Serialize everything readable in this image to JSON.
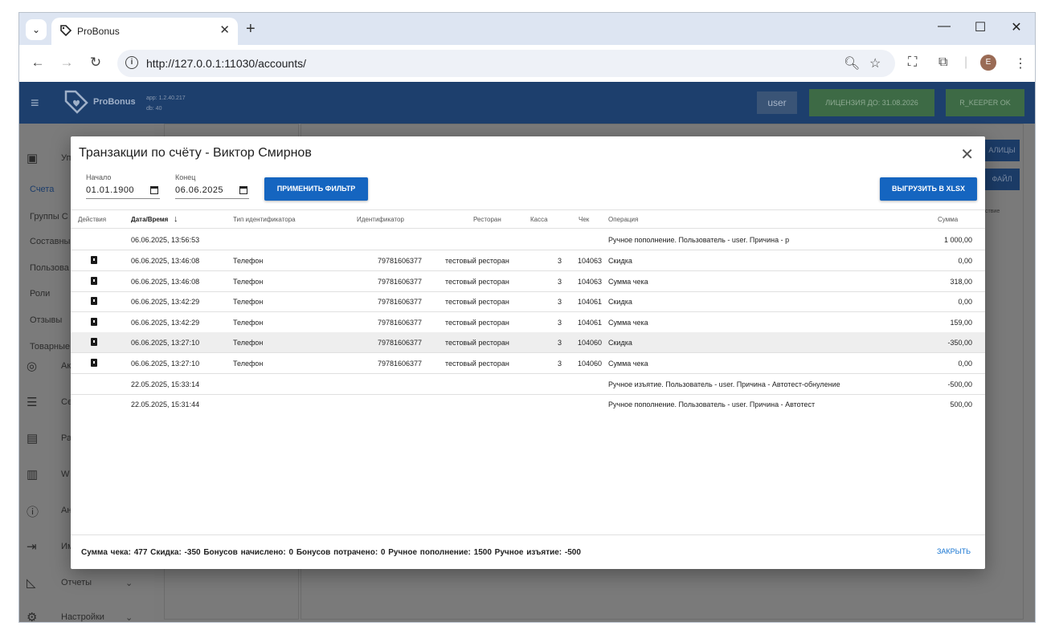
{
  "browser": {
    "tab_title": "ProBonus",
    "tab_close": "✕",
    "new_tab": "+",
    "url": "http://127.0.0.1:11030/accounts/",
    "profile_initial": "E",
    "window_controls": {
      "minimize": "—",
      "maximize": "☐",
      "close": "✕"
    }
  },
  "app": {
    "logo_text": "ProBonus",
    "version_app": "app: 1.2.40.217",
    "version_db": "db: 40",
    "user_label": "user",
    "license_label": "ЛИЦЕНЗИЯ ДО: 31.08.2026",
    "keeper_label": "R_KEEPER OK"
  },
  "sidebar": {
    "items": [
      {
        "label": "Уп"
      },
      {
        "label": "Счета"
      },
      {
        "label": "Группы С"
      },
      {
        "label": "Составны"
      },
      {
        "label": "Пользова"
      },
      {
        "label": "Роли"
      },
      {
        "label": "Отзывы"
      },
      {
        "label": "Товарные"
      }
    ],
    "icon_items": [
      {
        "icon": "eye-icon",
        "label": "Ак"
      },
      {
        "icon": "list-icon",
        "label": "Се"
      },
      {
        "icon": "card-icon",
        "label": "Ра"
      },
      {
        "icon": "wallet-icon",
        "label": "W"
      },
      {
        "icon": "alert-icon",
        "label": "Ан"
      },
      {
        "icon": "import-icon",
        "label": "Им"
      },
      {
        "icon": "chart-icon",
        "label": "Отчеты"
      },
      {
        "icon": "gear-icon",
        "label": "Настройки"
      }
    ]
  },
  "background": {
    "btn_tables": "АЛИЦЫ",
    "btn_file": "ФАЙЛ",
    "col_partial": "ствие"
  },
  "modal": {
    "title": "Транзакции по счёту - Виктор Смирнов",
    "start_label": "Начало",
    "start_value": "01.01.1900",
    "end_label": "Конец",
    "end_value": "06.06.2025",
    "apply_button": "ПРИМЕНИТЬ ФИЛЬТР",
    "export_button": "ВЫГРУЗИТЬ В XLSX",
    "columns": {
      "actions": "Действия",
      "datetime": "Дата/Время",
      "id_type": "Тип идентификатора",
      "identifier": "Идентификатор",
      "restaurant": "Ресторан",
      "cash": "Касса",
      "check": "Чек",
      "operation": "Операция",
      "sum": "Сумма"
    },
    "rows": [
      {
        "has_action": false,
        "datetime": "06.06.2025, 13:56:53",
        "id_type": "",
        "identifier": "",
        "restaurant": "",
        "cash": "",
        "check": "",
        "operation": "Ручное пополнение. Пользователь - user. Причина - р",
        "sum": "1 000,00"
      },
      {
        "has_action": true,
        "datetime": "06.06.2025, 13:46:08",
        "id_type": "Телефон",
        "identifier": "79781606377",
        "restaurant": "тестовый ресторан",
        "cash": "3",
        "check": "104063",
        "operation": "Скидка",
        "sum": "0,00"
      },
      {
        "has_action": true,
        "datetime": "06.06.2025, 13:46:08",
        "id_type": "Телефон",
        "identifier": "79781606377",
        "restaurant": "тестовый ресторан",
        "cash": "3",
        "check": "104063",
        "operation": "Сумма чека",
        "sum": "318,00"
      },
      {
        "has_action": true,
        "datetime": "06.06.2025, 13:42:29",
        "id_type": "Телефон",
        "identifier": "79781606377",
        "restaurant": "тестовый ресторан",
        "cash": "3",
        "check": "104061",
        "operation": "Скидка",
        "sum": "0,00"
      },
      {
        "has_action": true,
        "datetime": "06.06.2025, 13:42:29",
        "id_type": "Телефон",
        "identifier": "79781606377",
        "restaurant": "тестовый ресторан",
        "cash": "3",
        "check": "104061",
        "operation": "Сумма чека",
        "sum": "159,00"
      },
      {
        "has_action": true,
        "datetime": "06.06.2025, 13:27:10",
        "id_type": "Телефон",
        "identifier": "79781606377",
        "restaurant": "тестовый ресторан",
        "cash": "3",
        "check": "104060",
        "operation": "Скидка",
        "sum": "-350,00",
        "highlight": true
      },
      {
        "has_action": true,
        "datetime": "06.06.2025, 13:27:10",
        "id_type": "Телефон",
        "identifier": "79781606377",
        "restaurant": "тестовый ресторан",
        "cash": "3",
        "check": "104060",
        "operation": "Сумма чека",
        "sum": "0,00"
      },
      {
        "has_action": false,
        "datetime": "22.05.2025, 15:33:14",
        "id_type": "",
        "identifier": "",
        "restaurant": "",
        "cash": "",
        "check": "",
        "operation": "Ручное изъятие. Пользователь - user. Причина - Автотест-обнуление",
        "sum": "-500,00"
      },
      {
        "has_action": false,
        "datetime": "22.05.2025, 15:31:44",
        "id_type": "",
        "identifier": "",
        "restaurant": "",
        "cash": "",
        "check": "",
        "operation": "Ручное пополнение. Пользователь - user. Причина - Автотест",
        "sum": "500,00"
      }
    ],
    "footer_summary": "Сумма чека: 477   Скидка: -350   Бонусов начислено: 0   Бонусов потрачено: 0   Ручное пополнение: 1500   Ручное изъятие: -500",
    "close_button": "ЗАКРЫТЬ"
  }
}
